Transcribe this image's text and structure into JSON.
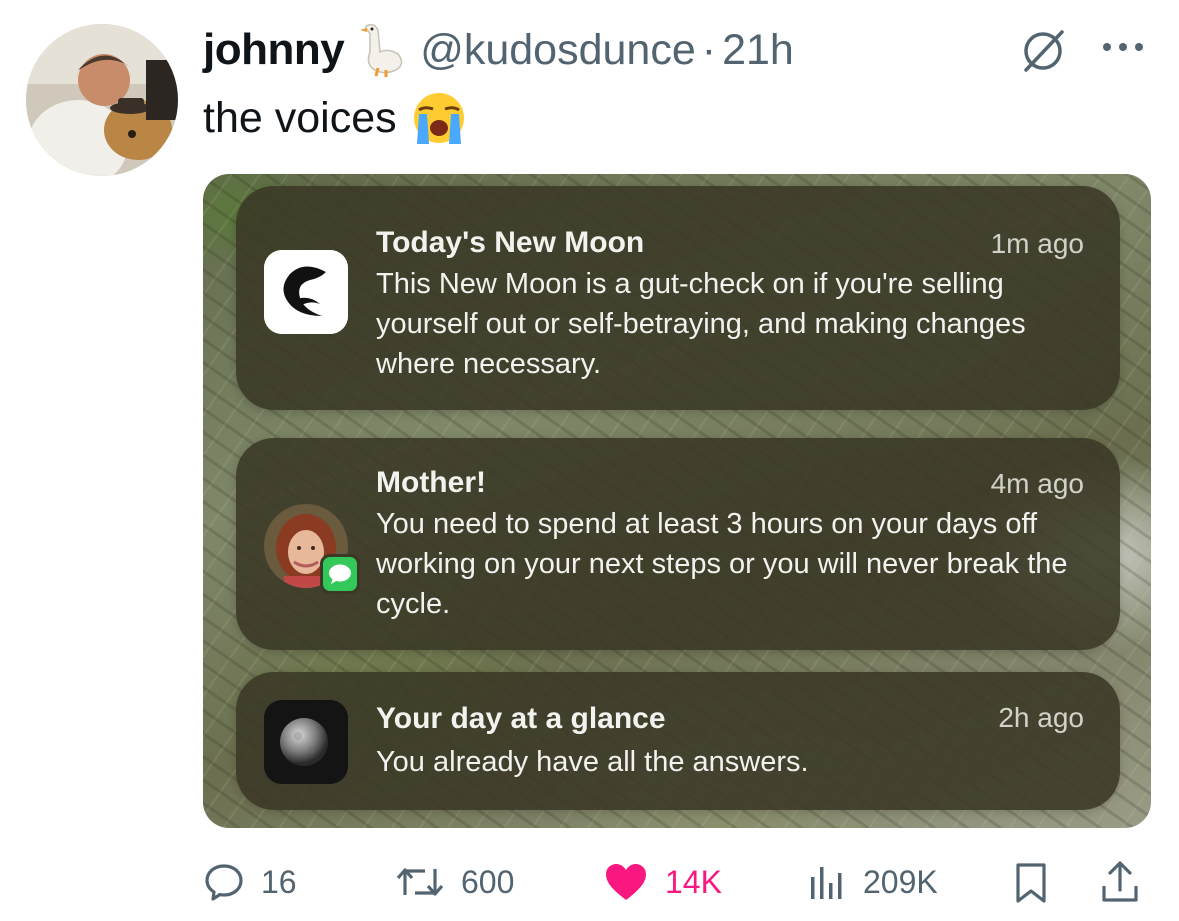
{
  "tweet": {
    "author_name": "johnny",
    "handle": "@kudosdunce",
    "separator": "·",
    "time": "21h",
    "text": "the voices",
    "badge_icon": "goose-emoji-icon",
    "text_emoji": "loudly-crying-face-emoji"
  },
  "notifications": [
    {
      "title": "Today's New Moon",
      "time": "1m ago",
      "body": "This New Moon is a gut-check on if you're selling yourself out or self-betraying, and making changes where necessary.",
      "icon": "moon-wave-app-icon"
    },
    {
      "title": "Mother!",
      "time": "4m ago",
      "body": "You need to spend at least 3 hours on your days off working on your next steps or you will never break the cycle.",
      "icon": "contact-photo-with-messages-badge"
    },
    {
      "title": "Your day at a glance",
      "time": "2h ago",
      "body": "You already have all the answers.",
      "icon": "moon-app-icon"
    }
  ],
  "actions": {
    "replies": "16",
    "reposts": "600",
    "likes": "14K",
    "views": "209K"
  },
  "colors": {
    "text_primary": "#0f1419",
    "text_secondary": "#536471",
    "like_pink": "#f91880",
    "notification_bg": "#3a3826",
    "imessage_green": "#34c759"
  }
}
